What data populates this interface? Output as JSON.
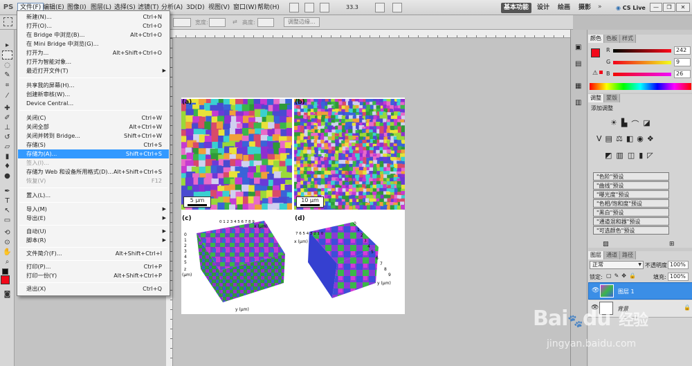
{
  "menubar": {
    "logo": "PS",
    "items": [
      "文件(F)",
      "编辑(E)",
      "图像(I)",
      "图层(L)",
      "选择(S)",
      "滤镜(T)",
      "分析(A)",
      "3D(D)",
      "视图(V)",
      "窗口(W)",
      "帮助(H)"
    ],
    "zoom": "33.3",
    "workspaces": [
      "基本功能",
      "设计",
      "绘画",
      "摄影"
    ],
    "cslive": "CS Live",
    "window_controls": [
      "—",
      "❐",
      "✕"
    ]
  },
  "options": {
    "width_label": "宽度:",
    "height_label": "高度:",
    "refine_button": "调整边缘..."
  },
  "file_menu": [
    {
      "label": "新建(N)...",
      "shortcut": "Ctrl+N"
    },
    {
      "label": "打开(O)...",
      "shortcut": "Ctrl+O"
    },
    {
      "label": "在 Bridge 中浏览(B)...",
      "shortcut": "Alt+Ctrl+O"
    },
    {
      "label": "在 Mini Bridge 中浏览(G)...",
      "shortcut": ""
    },
    {
      "label": "打开为...",
      "shortcut": "Alt+Shift+Ctrl+O"
    },
    {
      "label": "打开为智能对象...",
      "shortcut": ""
    },
    {
      "label": "最近打开文件(T)",
      "shortcut": ""
    },
    {
      "label": "共享我的屏幕(H)...",
      "shortcut": ""
    },
    {
      "label": "创建新审核(W)...",
      "shortcut": ""
    },
    {
      "label": "Device Central...",
      "shortcut": ""
    },
    {
      "label": "关闭(C)",
      "shortcut": "Ctrl+W"
    },
    {
      "label": "关闭全部",
      "shortcut": "Alt+Ctrl+W"
    },
    {
      "label": "关闭并转到 Bridge...",
      "shortcut": "Shift+Ctrl+W"
    },
    {
      "label": "存储(S)",
      "shortcut": "Ctrl+S"
    },
    {
      "label": "存储为(A)...",
      "shortcut": "Shift+Ctrl+S"
    },
    {
      "label": "签入(I)...",
      "shortcut": ""
    },
    {
      "label": "存储为 Web 和设备所用格式(D)...",
      "shortcut": "Alt+Shift+Ctrl+S"
    },
    {
      "label": "恢复(V)",
      "shortcut": "F12"
    },
    {
      "label": "置入(L)...",
      "shortcut": ""
    },
    {
      "label": "导入(M)",
      "shortcut": ""
    },
    {
      "label": "导出(E)",
      "shortcut": ""
    },
    {
      "label": "自动(U)",
      "shortcut": ""
    },
    {
      "label": "脚本(R)",
      "shortcut": ""
    },
    {
      "label": "文件简介(F)...",
      "shortcut": "Alt+Shift+Ctrl+I"
    },
    {
      "label": "打印(P)...",
      "shortcut": "Ctrl+P"
    },
    {
      "label": "打印一份(Y)",
      "shortcut": "Alt+Shift+Ctrl+P"
    },
    {
      "label": "退出(X)",
      "shortcut": "Ctrl+Q"
    }
  ],
  "document": {
    "panel_a": "(a)",
    "panel_b": "(b)",
    "panel_c": "(c)",
    "panel_d": "(d)",
    "scale_a": "5 μm",
    "scale_b": "10 μm",
    "c_axis_x": "x (μm)",
    "c_axis_y": "y (μm)",
    "c_axis_z_line1": "z",
    "c_axis_z_line2": "(μm)",
    "d_axis_x": "x (μm)",
    "d_axis_y": "y (μm)",
    "c_x_ticks": "0 1 2 3 4 5 6 7 8 9",
    "c_z_ticks": [
      "0",
      "1",
      "2",
      "3",
      "4",
      "5"
    ],
    "c_y_ticks": [
      "1",
      "3",
      "5",
      "7",
      "9"
    ],
    "d_x_ticks": "7 6 5 4 3 2 1 0",
    "d_y_ticks": [
      "0",
      "1",
      "2",
      "3",
      "4",
      "5",
      "6",
      "7",
      "8",
      "9"
    ]
  },
  "color_panel": {
    "tabs": [
      "颜色",
      "色板",
      "样式"
    ],
    "channels": [
      {
        "label": "R",
        "value": "242"
      },
      {
        "label": "G",
        "value": "9"
      },
      {
        "label": "B",
        "value": "26"
      }
    ],
    "foreground": "#f2091a"
  },
  "adjust_panel": {
    "tabs": [
      "调整",
      "蒙版"
    ],
    "title": "添加调整",
    "presets": [
      "\"色阶\"预设",
      "\"曲线\"预设",
      "\"曝光度\"预设",
      "\"色相/饱和度\"预设",
      "\"黑白\"预设",
      "\"通道混和器\"预设",
      "\"可选颜色\"预设"
    ]
  },
  "layers_panel": {
    "tabs": [
      "图层",
      "通道",
      "路径"
    ],
    "blend_mode": "正常",
    "opacity_label": "不透明度:",
    "opacity": "100%",
    "lock_label": "锁定:",
    "fill_label": "填充:",
    "fill": "100%",
    "layers": [
      {
        "name": "图层 1",
        "selected": true
      },
      {
        "name": "背景",
        "selected": false
      }
    ]
  },
  "watermark": {
    "brand": "Bai",
    "paw": "du",
    "cn": "经验",
    "url": "jingyan.baidu.com"
  }
}
